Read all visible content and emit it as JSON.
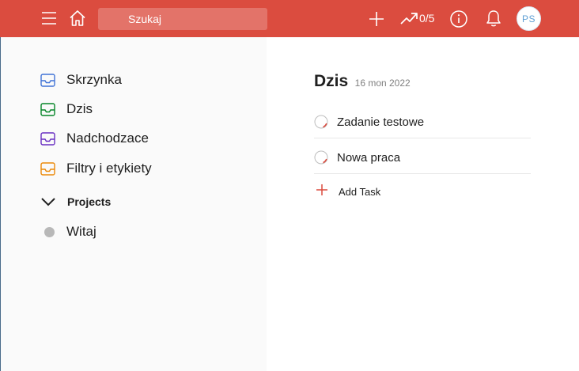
{
  "topbar": {
    "menu_icon": "hamburger-icon",
    "home_icon": "home-icon",
    "search_placeholder": "Szukaj",
    "add_icon": "plus-icon",
    "karma_icon": "trend-up-icon",
    "karma_text": "0/5",
    "info_icon": "info-icon",
    "notifications_icon": "bell-icon",
    "avatar_initials": "PS",
    "accent_color": "#db4c3f"
  },
  "sidebar": {
    "items": [
      {
        "label": "Skrzynka",
        "icon": "inbox-icon",
        "color": "#4073d6"
      },
      {
        "label": "Dzis",
        "icon": "inbox-icon",
        "color": "#058527"
      },
      {
        "label": "Nadchodzace",
        "icon": "inbox-icon",
        "color": "#692fc2"
      },
      {
        "label": "Filtry i etykiety",
        "icon": "inbox-icon",
        "color": "#eb8909"
      }
    ],
    "projects_label": "Projects",
    "projects": [
      {
        "label": "Witaj",
        "color": "#b8b8b8"
      }
    ]
  },
  "main": {
    "title": "Dzis",
    "date": "16 mon 2022",
    "tasks": [
      {
        "text": "Zadanie testowe"
      },
      {
        "text": "Nowa praca"
      }
    ],
    "add_task_label": "Add Task"
  }
}
